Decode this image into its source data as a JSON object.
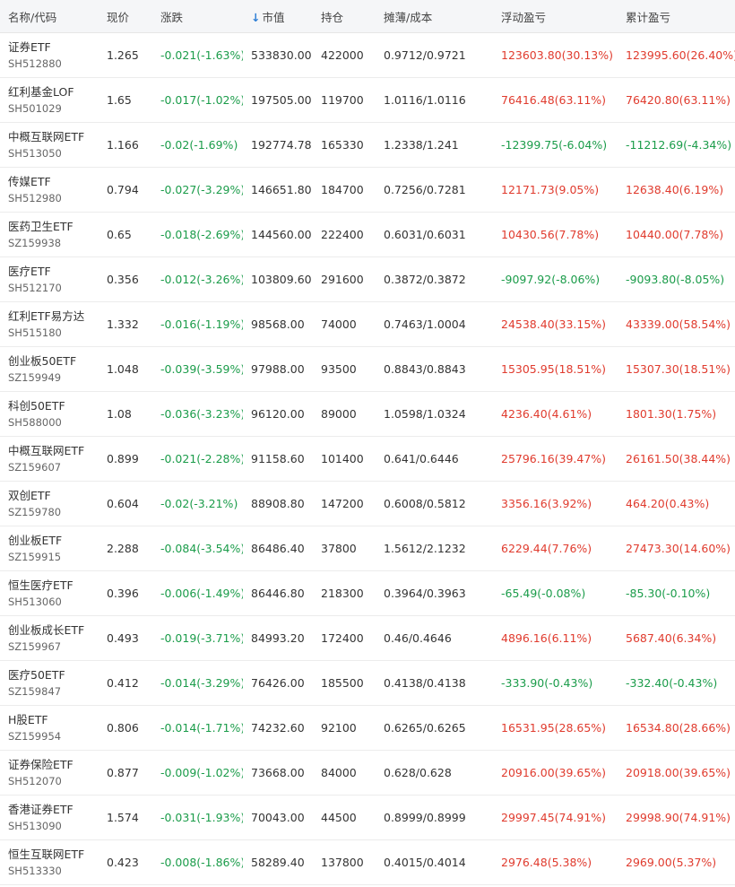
{
  "colors": {
    "gain": "#e03b2e",
    "loss": "#1b9c4a",
    "sort_arrow": "#2f7fd6",
    "header_bg": "#f5f6f8"
  },
  "header": {
    "name_code": "名称/代码",
    "price": "现价",
    "change": "涨跌",
    "sort_arrow_icon": "↓",
    "market_value": "市值",
    "position": "持仓",
    "cost": "摊薄/成本",
    "floating_pl": "浮动盈亏",
    "total_pl": "累计盈亏"
  },
  "rows": [
    {
      "name": "证券ETF",
      "code": "SH512880",
      "price": "1.265",
      "change": "-0.021(-1.63%)",
      "change_dir": "neg",
      "market_value": "533830.00",
      "position": "422000",
      "cost": "0.9712/0.9721",
      "floating_pl": "123603.80(30.13%)",
      "floating_dir": "pos",
      "total_pl": "123995.60(26.40%)",
      "total_dir": "pos"
    },
    {
      "name": "红利基金LOF",
      "code": "SH501029",
      "price": "1.65",
      "change": "-0.017(-1.02%)",
      "change_dir": "neg",
      "market_value": "197505.00",
      "position": "119700",
      "cost": "1.0116/1.0116",
      "floating_pl": "76416.48(63.11%)",
      "floating_dir": "pos",
      "total_pl": "76420.80(63.11%)",
      "total_dir": "pos"
    },
    {
      "name": "中概互联网ETF",
      "code": "SH513050",
      "price": "1.166",
      "change": "-0.02(-1.69%)",
      "change_dir": "neg",
      "market_value": "192774.78",
      "position": "165330",
      "cost": "1.2338/1.241",
      "floating_pl": "-12399.75(-6.04%)",
      "floating_dir": "neg",
      "total_pl": "-11212.69(-4.34%)",
      "total_dir": "neg"
    },
    {
      "name": "传媒ETF",
      "code": "SH512980",
      "price": "0.794",
      "change": "-0.027(-3.29%)",
      "change_dir": "neg",
      "market_value": "146651.80",
      "position": "184700",
      "cost": "0.7256/0.7281",
      "floating_pl": "12171.73(9.05%)",
      "floating_dir": "pos",
      "total_pl": "12638.40(6.19%)",
      "total_dir": "pos"
    },
    {
      "name": "医药卫生ETF",
      "code": "SZ159938",
      "price": "0.65",
      "change": "-0.018(-2.69%)",
      "change_dir": "neg",
      "market_value": "144560.00",
      "position": "222400",
      "cost": "0.6031/0.6031",
      "floating_pl": "10430.56(7.78%)",
      "floating_dir": "pos",
      "total_pl": "10440.00(7.78%)",
      "total_dir": "pos"
    },
    {
      "name": "医疗ETF",
      "code": "SH512170",
      "price": "0.356",
      "change": "-0.012(-3.26%)",
      "change_dir": "neg",
      "market_value": "103809.60",
      "position": "291600",
      "cost": "0.3872/0.3872",
      "floating_pl": "-9097.92(-8.06%)",
      "floating_dir": "neg",
      "total_pl": "-9093.80(-8.05%)",
      "total_dir": "neg"
    },
    {
      "name": "红利ETF易方达",
      "code": "SH515180",
      "price": "1.332",
      "change": "-0.016(-1.19%)",
      "change_dir": "neg",
      "market_value": "98568.00",
      "position": "74000",
      "cost": "0.7463/1.0004",
      "floating_pl": "24538.40(33.15%)",
      "floating_dir": "pos",
      "total_pl": "43339.00(58.54%)",
      "total_dir": "pos"
    },
    {
      "name": "创业板50ETF",
      "code": "SZ159949",
      "price": "1.048",
      "change": "-0.039(-3.59%)",
      "change_dir": "neg",
      "market_value": "97988.00",
      "position": "93500",
      "cost": "0.8843/0.8843",
      "floating_pl": "15305.95(18.51%)",
      "floating_dir": "pos",
      "total_pl": "15307.30(18.51%)",
      "total_dir": "pos"
    },
    {
      "name": "科创50ETF",
      "code": "SH588000",
      "price": "1.08",
      "change": "-0.036(-3.23%)",
      "change_dir": "neg",
      "market_value": "96120.00",
      "position": "89000",
      "cost": "1.0598/1.0324",
      "floating_pl": "4236.40(4.61%)",
      "floating_dir": "pos",
      "total_pl": "1801.30(1.75%)",
      "total_dir": "pos"
    },
    {
      "name": "中概互联网ETF",
      "code": "SZ159607",
      "price": "0.899",
      "change": "-0.021(-2.28%)",
      "change_dir": "neg",
      "market_value": "91158.60",
      "position": "101400",
      "cost": "0.641/0.6446",
      "floating_pl": "25796.16(39.47%)",
      "floating_dir": "pos",
      "total_pl": "26161.50(38.44%)",
      "total_dir": "pos"
    },
    {
      "name": "双创ETF",
      "code": "SZ159780",
      "price": "0.604",
      "change": "-0.02(-3.21%)",
      "change_dir": "neg",
      "market_value": "88908.80",
      "position": "147200",
      "cost": "0.6008/0.5812",
      "floating_pl": "3356.16(3.92%)",
      "floating_dir": "pos",
      "total_pl": "464.20(0.43%)",
      "total_dir": "pos"
    },
    {
      "name": "创业板ETF",
      "code": "SZ159915",
      "price": "2.288",
      "change": "-0.084(-3.54%)",
      "change_dir": "neg",
      "market_value": "86486.40",
      "position": "37800",
      "cost": "1.5612/2.1232",
      "floating_pl": "6229.44(7.76%)",
      "floating_dir": "pos",
      "total_pl": "27473.30(14.60%)",
      "total_dir": "pos"
    },
    {
      "name": "恒生医疗ETF",
      "code": "SH513060",
      "price": "0.396",
      "change": "-0.006(-1.49%)",
      "change_dir": "neg",
      "market_value": "86446.80",
      "position": "218300",
      "cost": "0.3964/0.3963",
      "floating_pl": "-65.49(-0.08%)",
      "floating_dir": "neg",
      "total_pl": "-85.30(-0.10%)",
      "total_dir": "neg"
    },
    {
      "name": "创业板成长ETF",
      "code": "SZ159967",
      "price": "0.493",
      "change": "-0.019(-3.71%)",
      "change_dir": "neg",
      "market_value": "84993.20",
      "position": "172400",
      "cost": "0.46/0.4646",
      "floating_pl": "4896.16(6.11%)",
      "floating_dir": "pos",
      "total_pl": "5687.40(6.34%)",
      "total_dir": "pos"
    },
    {
      "name": "医疗50ETF",
      "code": "SZ159847",
      "price": "0.412",
      "change": "-0.014(-3.29%)",
      "change_dir": "neg",
      "market_value": "76426.00",
      "position": "185500",
      "cost": "0.4138/0.4138",
      "floating_pl": "-333.90(-0.43%)",
      "floating_dir": "neg",
      "total_pl": "-332.40(-0.43%)",
      "total_dir": "neg"
    },
    {
      "name": "H股ETF",
      "code": "SZ159954",
      "price": "0.806",
      "change": "-0.014(-1.71%)",
      "change_dir": "neg",
      "market_value": "74232.60",
      "position": "92100",
      "cost": "0.6265/0.6265",
      "floating_pl": "16531.95(28.65%)",
      "floating_dir": "pos",
      "total_pl": "16534.80(28.66%)",
      "total_dir": "pos"
    },
    {
      "name": "证券保险ETF",
      "code": "SH512070",
      "price": "0.877",
      "change": "-0.009(-1.02%)",
      "change_dir": "neg",
      "market_value": "73668.00",
      "position": "84000",
      "cost": "0.628/0.628",
      "floating_pl": "20916.00(39.65%)",
      "floating_dir": "pos",
      "total_pl": "20918.00(39.65%)",
      "total_dir": "pos"
    },
    {
      "name": "香港证券ETF",
      "code": "SH513090",
      "price": "1.574",
      "change": "-0.031(-1.93%)",
      "change_dir": "neg",
      "market_value": "70043.00",
      "position": "44500",
      "cost": "0.8999/0.8999",
      "floating_pl": "29997.45(74.91%)",
      "floating_dir": "pos",
      "total_pl": "29998.90(74.91%)",
      "total_dir": "pos"
    },
    {
      "name": "恒生互联网ETF",
      "code": "SH513330",
      "price": "0.423",
      "change": "-0.008(-1.86%)",
      "change_dir": "neg",
      "market_value": "58289.40",
      "position": "137800",
      "cost": "0.4015/0.4014",
      "floating_pl": "2976.48(5.38%)",
      "floating_dir": "pos",
      "total_pl": "2969.00(5.37%)",
      "total_dir": "pos"
    }
  ]
}
